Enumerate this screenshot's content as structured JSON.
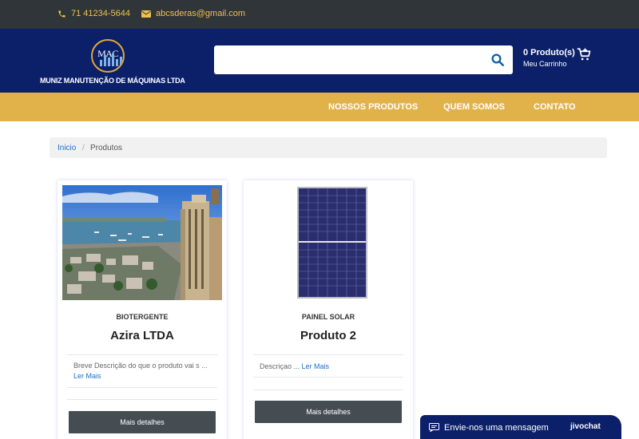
{
  "topbar": {
    "phone": "71 41234-5644",
    "email": "abcsderas@gmail.com",
    "phone_icon": "phone-icon",
    "email_icon": "envelope-icon"
  },
  "header": {
    "logo_text": "MAC",
    "brand_name": "MUNIZ MANUTENÇÃO DE MÁQUINAS LTDA",
    "search_placeholder": "",
    "search_value": "",
    "search_icon": "search-icon",
    "cart_count": "0 Produto(s)",
    "cart_label": "Meu Carrinho",
    "cart_icon": "cart-icon"
  },
  "nav": {
    "items": [
      {
        "label": "NOSSOS PRODUTOS"
      },
      {
        "label": "QUEM SOMOS"
      },
      {
        "label": "CONTATO"
      }
    ]
  },
  "breadcrumb": {
    "home": "Inicio",
    "separator": "/",
    "current": "Produtos"
  },
  "products": [
    {
      "category": "BIOTERGENTE",
      "title": "Azira LTDA",
      "description": "Breve Descrição do que o produto vai s ...",
      "read_more": "Ler Mais",
      "button": "Mais detalhes",
      "image": "city-photo"
    },
    {
      "category": "PAINEL SOLAR",
      "title": "Produto 2",
      "description": "Descriçao ...",
      "read_more": "Ler Mais",
      "button": "Mais detalhes",
      "image": "solar-panel-photo"
    }
  ],
  "chat": {
    "message": "Envie-nos uma mensagem",
    "brand": "jivochat",
    "icon": "chat-bubble-icon"
  },
  "colors": {
    "topbar": "#2f3539",
    "header": "#0b2069",
    "nav": "#e2b24a",
    "accent_text": "#f0c14b",
    "link": "#1e70c8",
    "button": "#454d52"
  }
}
